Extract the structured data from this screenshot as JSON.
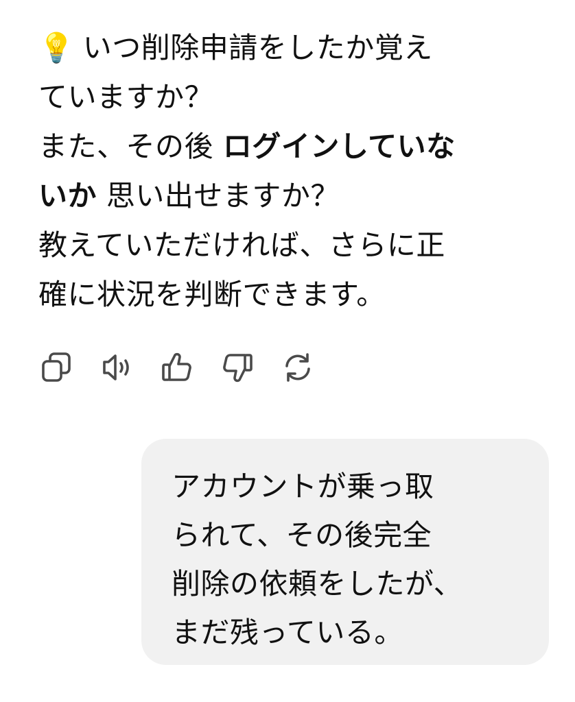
{
  "assistant_message": {
    "bulb_emoji": "💡",
    "line1": "いつ削除申請をしたか覚え",
    "line2": "ていますか？",
    "line3_prefix": "また、その後 ",
    "line3_bold": "ログインしていな",
    "line4_bold": "いか",
    "line4_suffix": " 思い出せますか？",
    "line5": "教えていただければ、さらに正",
    "line6": "確に状況を判断できます。"
  },
  "actions": [
    {
      "icon": "copy-icon"
    },
    {
      "icon": "speaker-icon"
    },
    {
      "icon": "thumbs-up-icon"
    },
    {
      "icon": "thumbs-down-icon"
    },
    {
      "icon": "regenerate-icon"
    }
  ],
  "user_message": {
    "line1": "アカウントが乗っ取",
    "line2": "られて、その後完全",
    "line3": "削除の依頼をしたが、",
    "line4": "まだ残っている。"
  },
  "colors": {
    "text": "#111111",
    "icon": "#4a4a4a",
    "bubble": "#f1f1f1"
  }
}
